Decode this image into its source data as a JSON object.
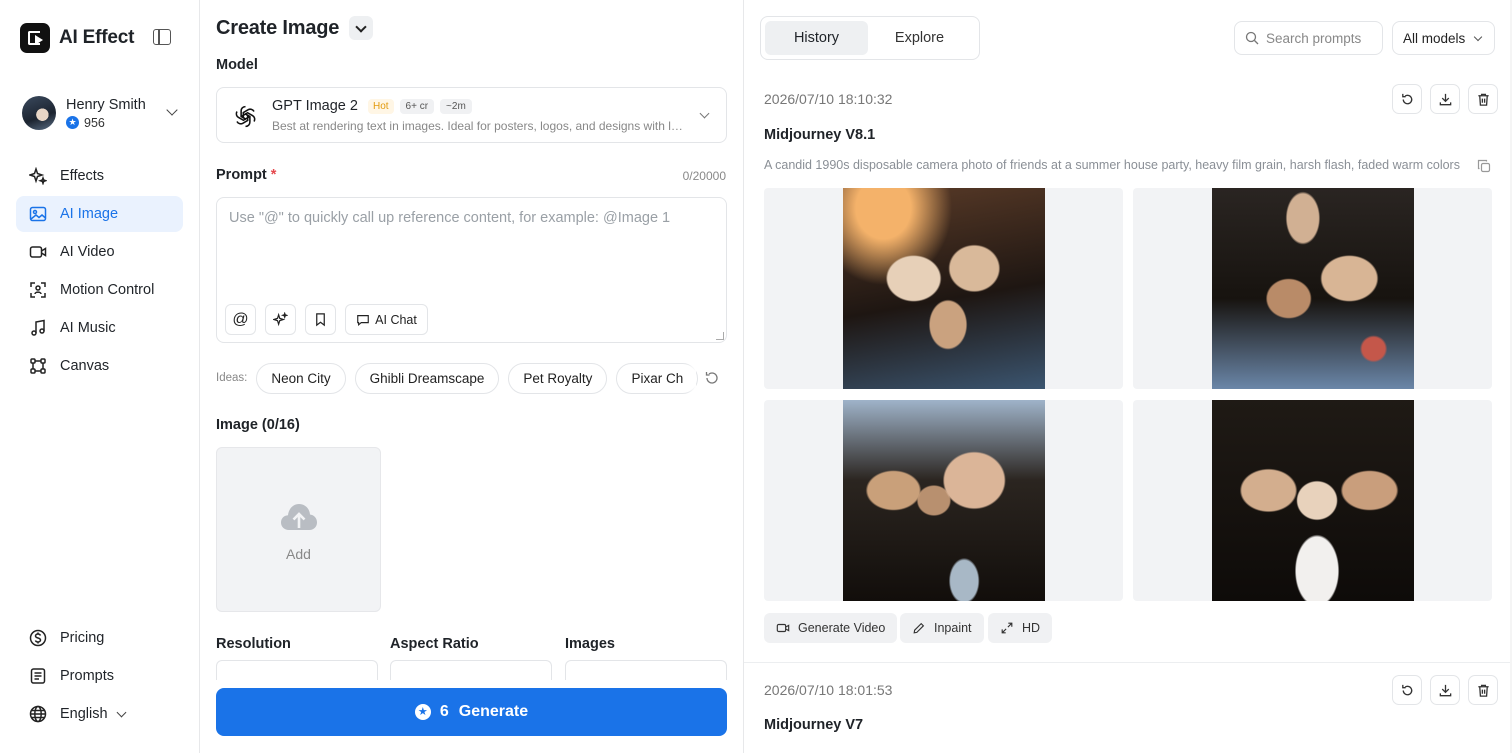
{
  "app": {
    "name": "AI Effect"
  },
  "user": {
    "name": "Henry Smith",
    "credits": "956"
  },
  "nav": {
    "items": [
      {
        "label": "Effects",
        "icon": "sparkle-icon"
      },
      {
        "label": "AI Image",
        "icon": "image-icon",
        "active": true
      },
      {
        "label": "AI Video",
        "icon": "video-icon"
      },
      {
        "label": "Motion Control",
        "icon": "motion-icon"
      },
      {
        "label": "AI Music",
        "icon": "music-icon"
      },
      {
        "label": "Canvas",
        "icon": "canvas-icon"
      }
    ],
    "bottom": [
      {
        "label": "Pricing",
        "icon": "dollar-icon"
      },
      {
        "label": "Prompts",
        "icon": "document-icon"
      },
      {
        "label": "English",
        "icon": "globe-icon"
      }
    ]
  },
  "create": {
    "title": "Create Image",
    "model_label": "Model",
    "model": {
      "name": "GPT Image 2",
      "hot": "Hot",
      "cost": "6+ cr",
      "time": "~2m",
      "description": "Best at rendering text in images. Ideal for posters, logos, and designs with legible text."
    },
    "prompt_label": "Prompt",
    "prompt_required": "*",
    "prompt_counter": "0/20000",
    "prompt_placeholder": "Use \"@\" to quickly call up reference content, for example: @Image 1",
    "prompt_value": "",
    "tools": {
      "mention": "@",
      "ai_chat": "AI Chat"
    },
    "ideas_label": "Ideas:",
    "ideas": [
      "Neon City",
      "Ghibli Dreamscape",
      "Pet Royalty",
      "Pixar Ch"
    ],
    "image_label": "Image (0/16)",
    "add_label": "Add",
    "resolution_label": "Resolution",
    "aspect_label": "Aspect Ratio",
    "images_label": "Images",
    "generate": {
      "count": "6",
      "label": "Generate"
    }
  },
  "history": {
    "tabs": [
      "History",
      "Explore"
    ],
    "active_tab": "History",
    "search_placeholder": "Search prompts",
    "model_filter": "All models",
    "entries": [
      {
        "date": "2026/07/10 18:10:32",
        "model": "Midjourney V8.1",
        "prompt": "A candid 1990s disposable camera photo of friends at a summer house party, heavy film grain, harsh flash, faded warm colors",
        "actions": [
          "Generate Video",
          "Inpaint",
          "HD"
        ]
      },
      {
        "date": "2026/07/10 18:01:53",
        "model": "Midjourney V7"
      }
    ]
  },
  "colors": {
    "accent": "#1a73e8",
    "active_nav_bg": "#eaf2fe",
    "hot_tag": "#e29a0d",
    "required": "#e5484d"
  }
}
